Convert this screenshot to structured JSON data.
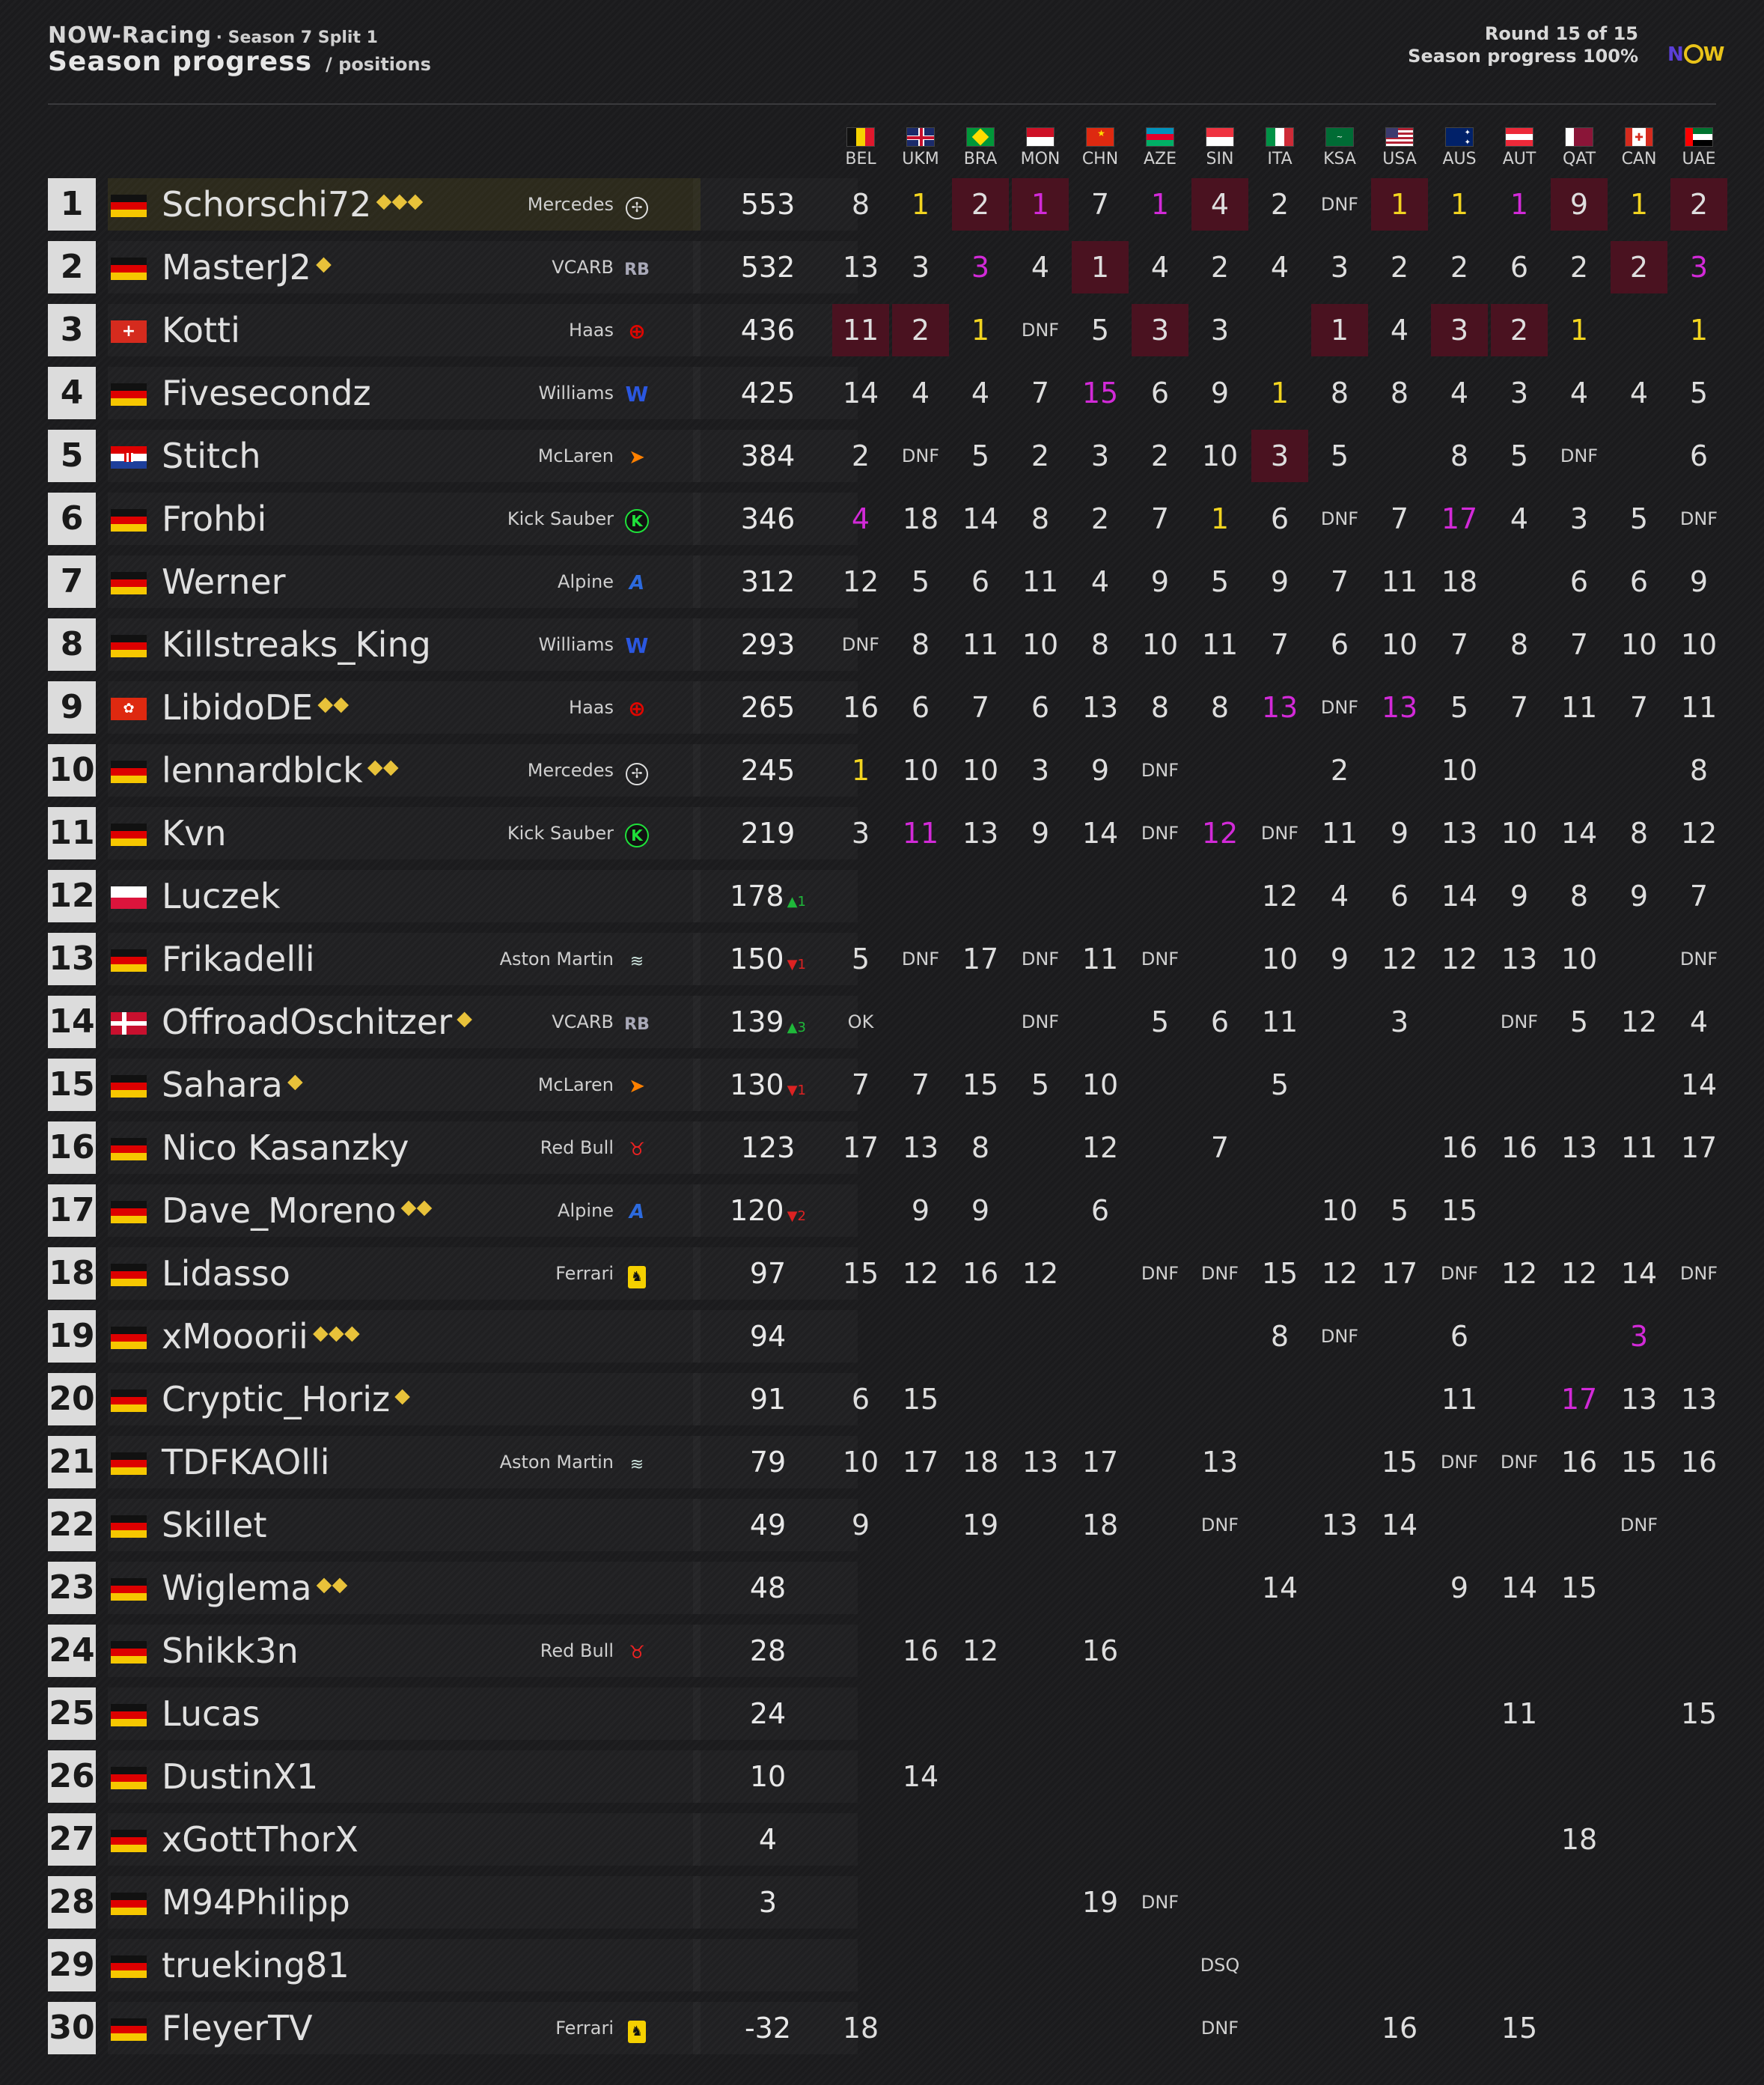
{
  "header": {
    "brand": "NOW-Racing",
    "season": "· Season 7 Split 1",
    "title": "Season progress",
    "subtitle": "/ positions",
    "round": "Round 15 of 15",
    "progress": "Season progress 100%"
  },
  "logo": {
    "n": "N",
    "w": "W"
  },
  "races": [
    "BEL",
    "UKM",
    "BRA",
    "MON",
    "CHN",
    "AZE",
    "SIN",
    "ITA",
    "KSA",
    "USA",
    "AUS",
    "AUT",
    "QAT",
    "CAN",
    "UAE"
  ],
  "colors": {
    "gold": "#f2d420",
    "purple": "#d22ad8",
    "highlight": "#4a1220",
    "up": "#1fb83a",
    "down": "#dd2222"
  },
  "drivers": [
    {
      "rank": "1",
      "name": "Schorschi72",
      "trophies": "⬥⬥⬥",
      "team": "Mercedes",
      "team_icon": "mercedes-icon",
      "flag": "de",
      "points": "553",
      "delta": "",
      "results": [
        "8",
        "1",
        "2",
        "1",
        "7",
        "1",
        "4",
        "2",
        "DNF",
        "1",
        "1",
        "1",
        "9",
        "1",
        "2"
      ]
    },
    {
      "rank": "2",
      "name": "MasterJ2",
      "trophies": "⬥",
      "team": "VCARB",
      "team_icon": "vcarb-icon",
      "flag": "de",
      "points": "532",
      "delta": "",
      "results": [
        "13",
        "3",
        "3",
        "4",
        "1",
        "4",
        "2",
        "4",
        "3",
        "2",
        "2",
        "6",
        "2",
        "2",
        "3"
      ]
    },
    {
      "rank": "3",
      "name": "Kotti",
      "trophies": "",
      "team": "Haas",
      "team_icon": "haas-icon",
      "flag": "ch",
      "points": "436",
      "delta": "",
      "results": [
        "11",
        "2",
        "1",
        "DNF",
        "5",
        "3",
        "3",
        "",
        "1",
        "4",
        "3",
        "2",
        "1",
        "",
        "1"
      ]
    },
    {
      "rank": "4",
      "name": "Fivesecondz",
      "trophies": "",
      "team": "Williams",
      "team_icon": "williams-icon",
      "flag": "de",
      "points": "425",
      "delta": "",
      "results": [
        "14",
        "4",
        "4",
        "7",
        "15",
        "6",
        "9",
        "1",
        "8",
        "8",
        "4",
        "3",
        "4",
        "4",
        "5"
      ]
    },
    {
      "rank": "5",
      "name": "Stitch",
      "trophies": "",
      "team": "McLaren",
      "team_icon": "mclaren-icon",
      "flag": "hr",
      "points": "384",
      "delta": "",
      "results": [
        "2",
        "DNF",
        "5",
        "2",
        "3",
        "2",
        "10",
        "3",
        "5",
        "",
        "8",
        "5",
        "DNF",
        "",
        "6"
      ]
    },
    {
      "rank": "6",
      "name": "Frohbi",
      "trophies": "",
      "team": "Kick Sauber",
      "team_icon": "sauber-icon",
      "flag": "de",
      "points": "346",
      "delta": "",
      "results": [
        "4",
        "18",
        "14",
        "8",
        "2",
        "7",
        "1",
        "6",
        "DNF",
        "7",
        "17",
        "4",
        "3",
        "5",
        "DNF"
      ]
    },
    {
      "rank": "7",
      "name": "Werner",
      "trophies": "",
      "team": "Alpine",
      "team_icon": "alpine-icon",
      "flag": "de",
      "points": "312",
      "delta": "",
      "results": [
        "12",
        "5",
        "6",
        "11",
        "4",
        "9",
        "5",
        "9",
        "7",
        "11",
        "18",
        "",
        "6",
        "6",
        "9"
      ]
    },
    {
      "rank": "8",
      "name": "Killstreaks_King",
      "trophies": "",
      "team": "Williams",
      "team_icon": "williams-icon",
      "flag": "de",
      "points": "293",
      "delta": "",
      "results": [
        "DNF",
        "8",
        "11",
        "10",
        "8",
        "10",
        "11",
        "7",
        "6",
        "10",
        "7",
        "8",
        "7",
        "10",
        "10"
      ]
    },
    {
      "rank": "9",
      "name": "LibidoDE",
      "trophies": "⬥⬥",
      "team": "Haas",
      "team_icon": "haas-icon",
      "flag": "hk",
      "points": "265",
      "delta": "",
      "results": [
        "16",
        "6",
        "7",
        "6",
        "13",
        "8",
        "8",
        "13",
        "DNF",
        "13",
        "5",
        "7",
        "11",
        "7",
        "11"
      ]
    },
    {
      "rank": "10",
      "name": "lennardblck",
      "trophies": "⬥⬥",
      "team": "Mercedes",
      "team_icon": "mercedes-icon",
      "flag": "de",
      "points": "245",
      "delta": "",
      "results": [
        "1",
        "10",
        "10",
        "3",
        "9",
        "DNF",
        "",
        "",
        "2",
        "",
        "10",
        "",
        "",
        "",
        "8"
      ]
    },
    {
      "rank": "11",
      "name": "Kvn",
      "trophies": "",
      "team": "Kick Sauber",
      "team_icon": "sauber-icon",
      "flag": "de",
      "points": "219",
      "delta": "",
      "results": [
        "3",
        "11",
        "13",
        "9",
        "14",
        "DNF",
        "12",
        "DNF",
        "11",
        "9",
        "13",
        "10",
        "14",
        "8",
        "12"
      ]
    },
    {
      "rank": "12",
      "name": "Luczek",
      "trophies": "",
      "team": "",
      "team_icon": "",
      "flag": "pl",
      "points": "178",
      "delta": "▲1",
      "results": [
        "",
        "",
        "",
        "",
        "",
        "",
        "",
        "12",
        "4",
        "6",
        "14",
        "9",
        "8",
        "9",
        "7"
      ]
    },
    {
      "rank": "13",
      "name": "Frikadelli",
      "trophies": "",
      "team": "Aston Martin",
      "team_icon": "aston-icon",
      "flag": "de",
      "points": "150",
      "delta": "▼1",
      "results": [
        "5",
        "DNF",
        "17",
        "DNF",
        "11",
        "DNF",
        "",
        "10",
        "9",
        "12",
        "12",
        "13",
        "10",
        "",
        "DNF"
      ]
    },
    {
      "rank": "14",
      "name": "OffroadOschitzer",
      "trophies": "⬥",
      "team": "VCARB",
      "team_icon": "vcarb-icon",
      "flag": "dk",
      "points": "139",
      "delta": "▲3",
      "results": [
        "OK",
        "",
        "",
        "DNF",
        "",
        "5",
        "6",
        "11",
        "",
        "3",
        "",
        "DNF",
        "5",
        "12",
        "4"
      ]
    },
    {
      "rank": "15",
      "name": "Sahara",
      "trophies": "⬥",
      "team": "McLaren",
      "team_icon": "mclaren-icon",
      "flag": "de",
      "points": "130",
      "delta": "▼1",
      "results": [
        "7",
        "7",
        "15",
        "5",
        "10",
        "",
        "",
        "5",
        "",
        "",
        "",
        "",
        "",
        "",
        "14"
      ]
    },
    {
      "rank": "16",
      "name": "Nico Kasanzky",
      "trophies": "",
      "team": "Red Bull",
      "team_icon": "redbull-icon",
      "flag": "de",
      "points": "123",
      "delta": "",
      "results": [
        "17",
        "13",
        "8",
        "",
        "12",
        "",
        "7",
        "",
        "",
        "",
        "16",
        "16",
        "13",
        "11",
        "17"
      ]
    },
    {
      "rank": "17",
      "name": "Dave_Moreno",
      "trophies": "⬥⬥",
      "team": "Alpine",
      "team_icon": "alpine-icon",
      "flag": "de",
      "points": "120",
      "delta": "▼2",
      "results": [
        "",
        "9",
        "9",
        "",
        "6",
        "",
        "",
        "",
        "10",
        "5",
        "15",
        "",
        "",
        "",
        ""
      ]
    },
    {
      "rank": "18",
      "name": "Lidasso",
      "trophies": "",
      "team": "Ferrari",
      "team_icon": "ferrari-icon",
      "flag": "de",
      "points": "97",
      "delta": "",
      "results": [
        "15",
        "12",
        "16",
        "12",
        "",
        "DNF",
        "DNF",
        "15",
        "12",
        "17",
        "DNF",
        "12",
        "12",
        "14",
        "DNF"
      ]
    },
    {
      "rank": "19",
      "name": "xMooorii",
      "trophies": "⬥⬥⬥",
      "team": "",
      "team_icon": "",
      "flag": "de",
      "points": "94",
      "delta": "",
      "results": [
        "",
        "",
        "",
        "",
        "",
        "",
        "",
        "8",
        "DNF",
        "",
        "6",
        "",
        "",
        "3",
        ""
      ]
    },
    {
      "rank": "20",
      "name": "Cryptic_Horiz",
      "trophies": "⬥",
      "team": "",
      "team_icon": "",
      "flag": "de",
      "points": "91",
      "delta": "",
      "results": [
        "6",
        "15",
        "",
        "",
        "",
        "",
        "",
        "",
        "",
        "",
        "11",
        "",
        "17",
        "13",
        "13"
      ]
    },
    {
      "rank": "21",
      "name": "TDFKAOlli",
      "trophies": "",
      "team": "Aston Martin",
      "team_icon": "aston-icon",
      "flag": "de",
      "points": "79",
      "delta": "",
      "results": [
        "10",
        "17",
        "18",
        "13",
        "17",
        "",
        "13",
        "",
        "",
        "15",
        "DNF",
        "DNF",
        "16",
        "15",
        "16"
      ]
    },
    {
      "rank": "22",
      "name": "Skillet",
      "trophies": "",
      "team": "",
      "team_icon": "",
      "flag": "de",
      "points": "49",
      "delta": "",
      "results": [
        "9",
        "",
        "19",
        "",
        "18",
        "",
        "DNF",
        "",
        "13",
        "14",
        "",
        "",
        "",
        "DNF",
        ""
      ]
    },
    {
      "rank": "23",
      "name": "Wiglema",
      "trophies": "⬥⬥",
      "team": "",
      "team_icon": "",
      "flag": "de",
      "points": "48",
      "delta": "",
      "results": [
        "",
        "",
        "",
        "",
        "",
        "",
        "",
        "14",
        "",
        "",
        "9",
        "14",
        "15",
        "",
        ""
      ]
    },
    {
      "rank": "24",
      "name": "Shikk3n",
      "trophies": "",
      "team": "Red Bull",
      "team_icon": "redbull-icon",
      "flag": "de",
      "points": "28",
      "delta": "",
      "results": [
        "",
        "16",
        "12",
        "",
        "16",
        "",
        "",
        "",
        "",
        "",
        "",
        "",
        "",
        "",
        ""
      ]
    },
    {
      "rank": "25",
      "name": "Lucas",
      "trophies": "",
      "team": "",
      "team_icon": "",
      "flag": "de",
      "points": "24",
      "delta": "",
      "results": [
        "",
        "",
        "",
        "",
        "",
        "",
        "",
        "",
        "",
        "",
        "",
        "11",
        "",
        "",
        "15"
      ]
    },
    {
      "rank": "26",
      "name": "DustinX1",
      "trophies": "",
      "team": "",
      "team_icon": "",
      "flag": "de",
      "points": "10",
      "delta": "",
      "results": [
        "",
        "14",
        "",
        "",
        "",
        "",
        "",
        "",
        "",
        "",
        "",
        "",
        "",
        "",
        ""
      ]
    },
    {
      "rank": "27",
      "name": "xGottThorX",
      "trophies": "",
      "team": "",
      "team_icon": "",
      "flag": "de",
      "points": "4",
      "delta": "",
      "results": [
        "",
        "",
        "",
        "",
        "",
        "",
        "",
        "",
        "",
        "",
        "",
        "",
        "18",
        "",
        ""
      ]
    },
    {
      "rank": "28",
      "name": "M94Philipp",
      "trophies": "",
      "team": "",
      "team_icon": "",
      "flag": "de",
      "points": "3",
      "delta": "",
      "results": [
        "",
        "",
        "",
        "",
        "19",
        "DNF",
        "",
        "",
        "",
        "",
        "",
        "",
        "",
        "",
        ""
      ]
    },
    {
      "rank": "29",
      "name": "trueking81",
      "trophies": "",
      "team": "",
      "team_icon": "",
      "flag": "de",
      "points": "",
      "delta": "",
      "results": [
        "",
        "",
        "",
        "",
        "",
        "",
        "DSQ",
        "",
        "",
        "",
        "",
        "",
        "",
        "",
        ""
      ]
    },
    {
      "rank": "30",
      "name": "FleyerTV",
      "trophies": "",
      "team": "Ferrari",
      "team_icon": "ferrari-icon",
      "flag": "de",
      "points": "-32",
      "delta": "",
      "results": [
        "18",
        "",
        "",
        "",
        "",
        "",
        "DNF",
        "",
        "",
        "16",
        "",
        "15",
        "",
        "",
        ""
      ]
    }
  ],
  "cell_styles": {
    "gold": [
      "0-1",
      "0-9",
      "0-10",
      "0-13",
      "2-2",
      "2-12",
      "2-14",
      "3-7",
      "5-6",
      "9-0"
    ],
    "purple": [
      "0-3",
      "0-5",
      "0-11",
      "1-2",
      "1-14",
      "3-4",
      "5-0",
      "5-10",
      "8-7",
      "8-9",
      "10-1",
      "10-6",
      "18-13",
      "19-12"
    ],
    "highlight": [
      "0-2",
      "0-3",
      "0-6",
      "0-9",
      "0-12",
      "0-14",
      "1-4",
      "1-13",
      "2-0",
      "2-1",
      "2-5",
      "2-8",
      "2-10",
      "2-11",
      "4-7"
    ]
  }
}
